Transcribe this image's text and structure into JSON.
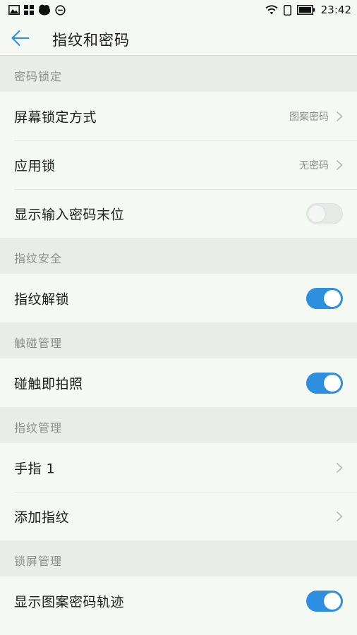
{
  "status_bar": {
    "time": "23:42",
    "left_icons": [
      "image-icon",
      "grid-icon",
      "cloud-icon",
      "minus-circle-icon"
    ],
    "right_icons": [
      "wifi-icon",
      "phone-outline-icon",
      "battery-icon"
    ]
  },
  "toolbar": {
    "title": "指纹和密码",
    "back_icon": "arrow-left-icon"
  },
  "accent_color": "#2d8fe0",
  "sections": [
    {
      "header": "密码锁定",
      "rows": [
        {
          "label": "屏幕锁定方式",
          "value": "图案密码",
          "control": "chevron"
        },
        {
          "label": "应用锁",
          "value": "无密码",
          "control": "chevron"
        },
        {
          "label": "显示输入密码末位",
          "control": "toggle",
          "on": false
        }
      ]
    },
    {
      "header": "指纹安全",
      "rows": [
        {
          "label": "指纹解锁",
          "control": "toggle",
          "on": true
        }
      ]
    },
    {
      "header": "触碰管理",
      "rows": [
        {
          "label": "碰触即拍照",
          "control": "toggle",
          "on": true
        }
      ]
    },
    {
      "header": "指纹管理",
      "rows": [
        {
          "label": "手指 1",
          "control": "chevron"
        },
        {
          "label": "添加指纹",
          "control": "chevron"
        }
      ]
    },
    {
      "header": "锁屏管理",
      "rows": [
        {
          "label": "显示图案密码轨迹",
          "control": "toggle",
          "on": true
        }
      ]
    }
  ]
}
